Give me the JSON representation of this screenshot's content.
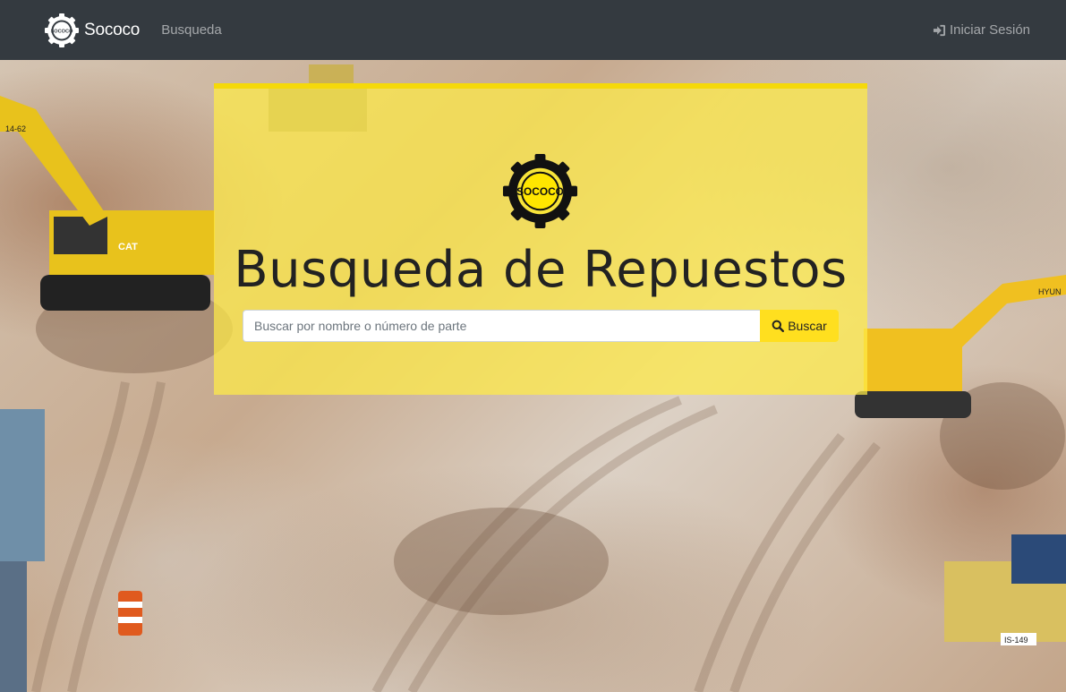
{
  "navbar": {
    "brand_name": "Sococo",
    "brand_logo_text": "SOCOCO",
    "nav_link": "Busqueda",
    "login_label": "Iniciar Sesión"
  },
  "hero": {
    "logo_text": "SOCOCO",
    "title": "Busqueda de Repuestos",
    "search_placeholder": "Buscar por nombre o número de parte",
    "search_button_label": "Buscar"
  },
  "background": {
    "vehicle_labels": [
      "14-62",
      "CAT",
      "HYUN",
      "IS-149"
    ]
  },
  "colors": {
    "navbar": "#343a40",
    "accent_yellow": "#ffdf1f",
    "hero_overlay": "#ffec46",
    "title_text": "#222222"
  },
  "icons": [
    "sococo-gear-logo-icon",
    "sign-in-icon",
    "search-icon"
  ]
}
